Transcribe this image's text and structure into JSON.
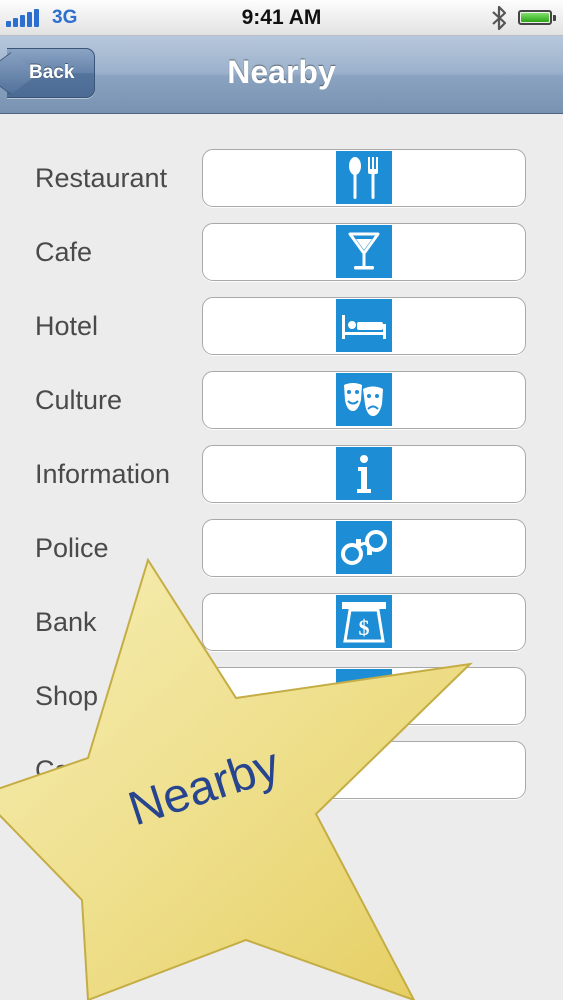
{
  "status_bar": {
    "carrier": "3G",
    "time": "9:41 AM",
    "battery_level": 1.0
  },
  "nav": {
    "back_label": "Back",
    "title": "Nearby"
  },
  "list": {
    "items": [
      {
        "label": "Restaurant",
        "icon": "restaurant-icon"
      },
      {
        "label": "Cafe",
        "icon": "cocktail-icon"
      },
      {
        "label": "Hotel",
        "icon": "bed-icon"
      },
      {
        "label": "Culture",
        "icon": "theater-masks-icon"
      },
      {
        "label": "Information",
        "icon": "info-icon"
      },
      {
        "label": "Police",
        "icon": "handcuffs-icon"
      },
      {
        "label": "Bank",
        "icon": "atm-icon"
      },
      {
        "label": "Shop",
        "icon": "shop-icon"
      },
      {
        "label": "Ca",
        "icon": "unknown-icon"
      }
    ]
  },
  "overlay": {
    "star_text": "Nearby"
  },
  "colors": {
    "icon_tile": "#1d8ed6",
    "nav_bar": "#8aa3c0",
    "star": "#f0e39a",
    "star_text": "#27448f"
  }
}
